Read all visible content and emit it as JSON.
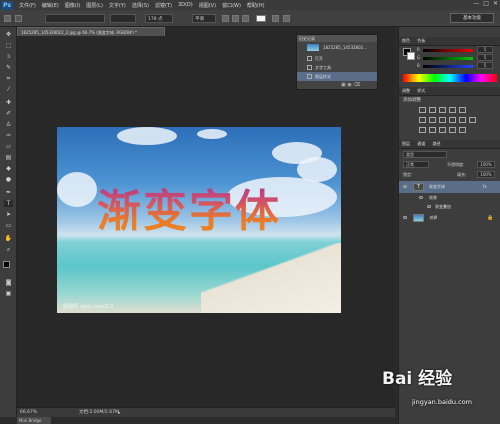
{
  "menubar": {
    "logo": "Ps",
    "items": [
      "文件(F)",
      "编辑(E)",
      "图像(I)",
      "图层(L)",
      "文字(Y)",
      "选择(S)",
      "滤镜(T)",
      "3D(D)",
      "视图(V)",
      "窗口(W)",
      "帮助(H)"
    ],
    "window_controls": [
      "—",
      "□",
      "✕"
    ]
  },
  "options": {
    "font_size": "178 点",
    "aa_mode": "平滑",
    "workspace": "基本功能"
  },
  "document": {
    "tab_title": "1825285_145328022_2.jpg @ 66.7% (渐变字体, RGB/8#) *",
    "canvas_text": "渐变字体",
    "watermark": "昵图网 nipic.com/2.0"
  },
  "status": {
    "zoom": "66.67%",
    "doc_size": "文档:2.00M/2.67M",
    "bottom_tab": "Mini Bridge"
  },
  "history": {
    "tabs": [
      "历史记录"
    ],
    "snapshot": "1825285_14532802...",
    "items": [
      "打开",
      "文字工具",
      "图层样式"
    ]
  },
  "color_panel": {
    "tabs": [
      "颜色",
      "色板"
    ],
    "channels": [
      {
        "label": "R",
        "value": "5"
      },
      {
        "label": "G",
        "value": "5"
      },
      {
        "label": "B",
        "value": "5"
      }
    ]
  },
  "adjust_panel": {
    "tabs": [
      "调整",
      "样式"
    ],
    "title": "添加调整"
  },
  "layers_panel": {
    "tabs": [
      "图层",
      "通道",
      "路径"
    ],
    "filter": "类型",
    "blend_mode": "正常",
    "opacity_label": "不透明度:",
    "opacity": "100%",
    "lock_label": "锁定:",
    "fill_label": "填充:",
    "fill": "100%",
    "layers": [
      {
        "name": "渐变字体",
        "fx": "fx"
      },
      {
        "name": "效果"
      },
      {
        "name": "渐变叠加"
      },
      {
        "name": "背景"
      }
    ]
  },
  "site_watermark": {
    "logo": "Bai 经验",
    "url": "jingyan.baidu.com"
  }
}
